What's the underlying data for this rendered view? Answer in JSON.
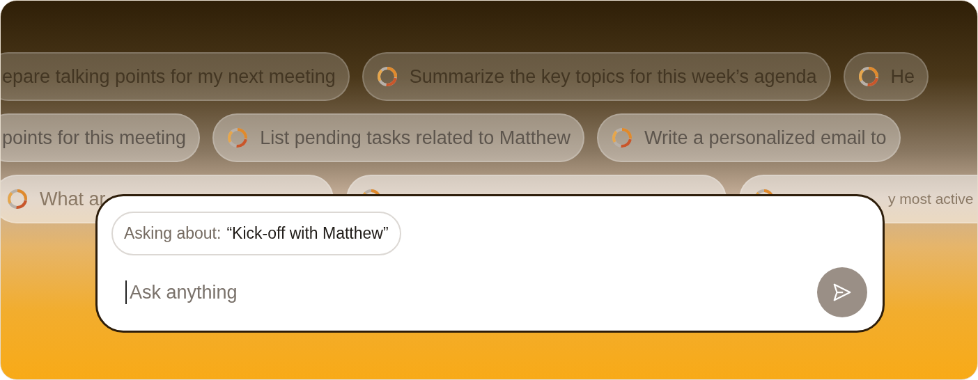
{
  "suggestion_rows": [
    {
      "chips": [
        {
          "icon": false,
          "text": "epare talking points for my next meeting"
        },
        {
          "icon": true,
          "text": "Summarize the key topics for this week’s agenda"
        },
        {
          "icon": true,
          "text": "He"
        }
      ]
    },
    {
      "chips": [
        {
          "icon": false,
          "text": "points for this meeting"
        },
        {
          "icon": true,
          "text": "List pending tasks related to Matthew"
        },
        {
          "icon": true,
          "text": "Write a personalized email to"
        }
      ]
    },
    {
      "chips": [
        {
          "icon": true,
          "text": "What ar"
        },
        {
          "icon": true
        },
        {
          "icon": true,
          "text": "y most active"
        }
      ]
    }
  ],
  "context": {
    "label": "Asking about:",
    "value": "“Kick-off with Matthew”"
  },
  "input": {
    "placeholder": "Ask anything"
  }
}
